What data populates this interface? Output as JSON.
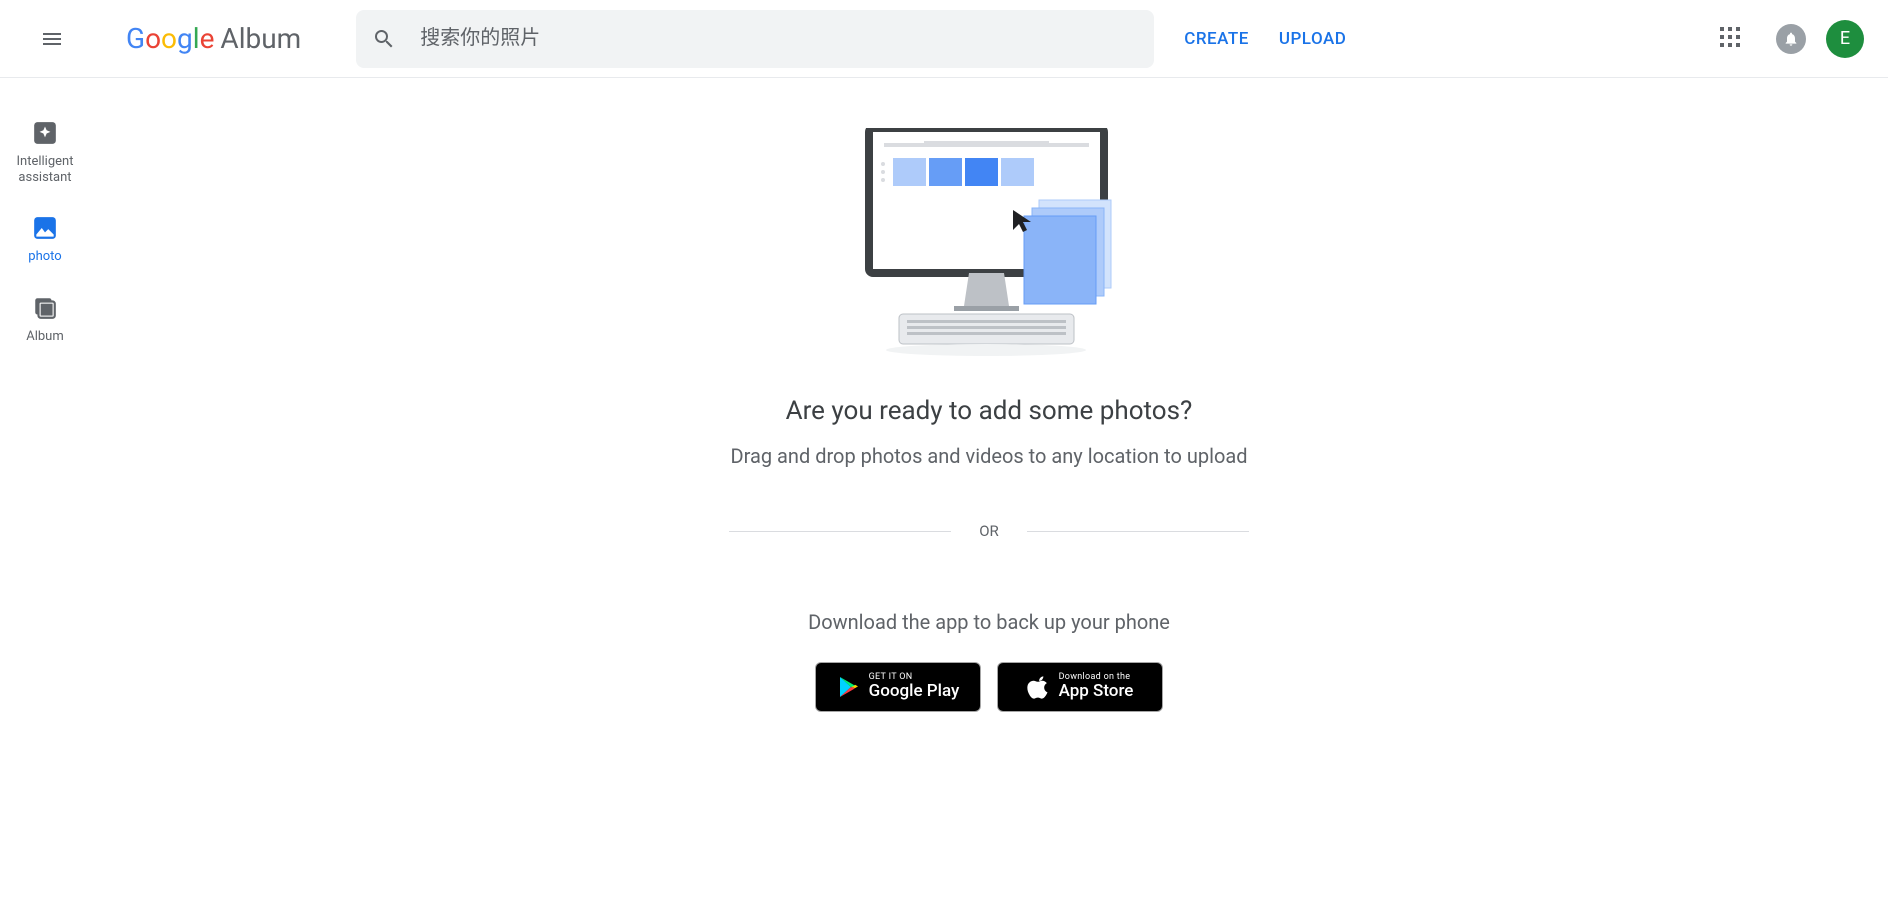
{
  "header": {
    "logo_suffix": "Album",
    "search_placeholder": "搜索你的照片",
    "create": "CREATE",
    "upload": "UPLOAD",
    "avatar_letter": "E"
  },
  "sidebar": {
    "items": [
      {
        "label": "Intelligent\nassistant"
      },
      {
        "label": "photo"
      },
      {
        "label": "Album"
      }
    ]
  },
  "main": {
    "title": "Are you ready to add some photos?",
    "subtitle": "Drag and drop photos and videos to any location to upload",
    "or": "OR",
    "download_text": "Download the app to back up your phone",
    "google_play_top": "GET IT ON",
    "google_play_bot": "Google Play",
    "app_store_top": "Download on the",
    "app_store_bot": "App Store"
  }
}
